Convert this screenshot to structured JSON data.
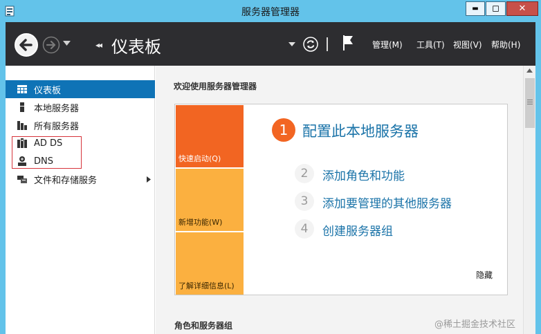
{
  "window": {
    "title": "服务器管理器",
    "min_label": "▬",
    "max_label": "◻",
    "close_label": "✕"
  },
  "toolbar": {
    "breadcrumb_arrows": "◂◂",
    "page_title": "仪表板",
    "menus": [
      "管理(M)",
      "工具(T)",
      "视图(V)",
      "帮助(H)"
    ]
  },
  "sidebar": {
    "items": [
      {
        "label": "仪表板",
        "icon": "dashboard-icon",
        "active": true
      },
      {
        "label": "本地服务器",
        "icon": "local-server-icon"
      },
      {
        "label": "所有服务器",
        "icon": "all-servers-icon"
      },
      {
        "label": "AD DS",
        "icon": "ad-ds-icon"
      },
      {
        "label": "DNS",
        "icon": "dns-icon"
      },
      {
        "label": "文件和存储服务",
        "icon": "file-storage-icon",
        "has_submenu": true
      }
    ]
  },
  "main": {
    "welcome_title": "欢迎使用服务器管理器",
    "tiles": [
      "快速启动(Q)",
      "新增功能(W)",
      "了解详细信息(L)"
    ],
    "steps": [
      {
        "num": "1",
        "label": "配置此本地服务器"
      },
      {
        "num": "2",
        "label": "添加角色和功能"
      },
      {
        "num": "3",
        "label": "添加要管理的其他服务器"
      },
      {
        "num": "4",
        "label": "创建服务器组"
      }
    ],
    "hide_label": "隐藏",
    "roles_header": "角色和服务器组"
  },
  "watermark": "@稀土掘金技术社区",
  "colors": {
    "titlebar": "#63c3ea",
    "toolbar": "#2d2d30",
    "active_nav": "#0f73b6",
    "tile_primary": "#f26522",
    "tile_secondary": "#fbb040",
    "link": "#1a73a8",
    "highlight_border": "#d6333a"
  }
}
